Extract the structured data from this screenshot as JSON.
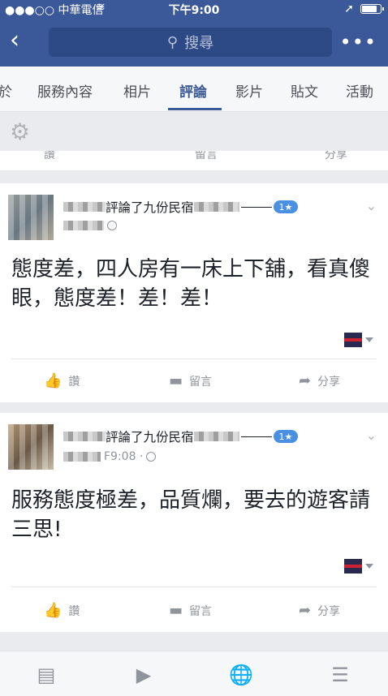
{
  "status_bar": {
    "carrier": "●●●○○ 中華電信",
    "wifi_glyph": "≋",
    "time": "下午9:00",
    "location_glyph": "➚"
  },
  "nav": {
    "back_glyph": "‹",
    "search_glyph": "⚲",
    "search_placeholder": "搜尋",
    "more_glyph": "•••"
  },
  "tabs": [
    {
      "label": "於"
    },
    {
      "label": "服務內容"
    },
    {
      "label": "相片"
    },
    {
      "label": "評論",
      "active": true
    },
    {
      "label": "影片"
    },
    {
      "label": "貼文"
    },
    {
      "label": "活動"
    }
  ],
  "settings": {
    "gear_glyph": "⚙"
  },
  "partial_actions": {
    "like": "讚",
    "comment": "留言",
    "share": "分享"
  },
  "posts": [
    {
      "reviewed_text": "評論了九份民宿",
      "rating": "1★",
      "meta_time": "",
      "body": "態度差，四人房有一床上下舖，看真傻眼，態度差！差！差！",
      "actions": {
        "like": "讚",
        "comment": "留言",
        "share": "分享"
      }
    },
    {
      "reviewed_text": "評論了九份民宿",
      "rating": "1★",
      "meta_time": "F9:08 ·",
      "body": "服務態度極差，品質爛，要去的遊客請三思!",
      "actions": {
        "like": "讚",
        "comment": "留言",
        "share": "分享"
      }
    }
  ],
  "icons": {
    "chevron": "⌄",
    "like": "👍",
    "comment": "▬",
    "share": "➦",
    "news_feed": "▤",
    "video": "▶",
    "globe": "🌐",
    "menu": "☰"
  },
  "colors": {
    "brand": "#3b5998",
    "accent": "#4a90e2"
  }
}
